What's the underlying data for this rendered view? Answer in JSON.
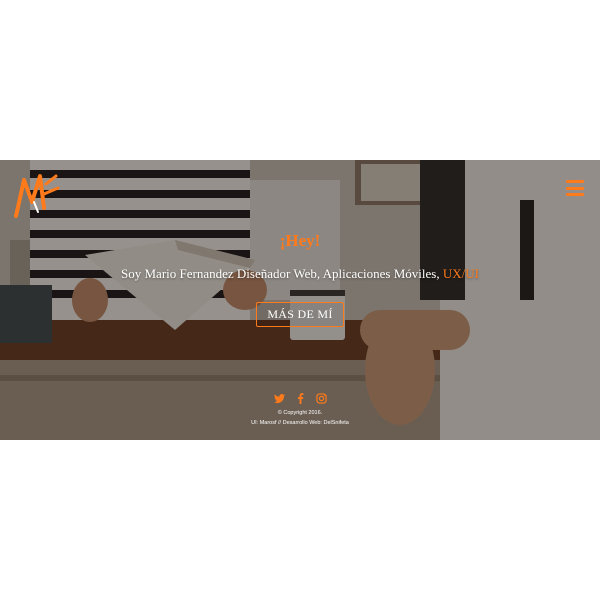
{
  "header": {
    "logo_icon": "mf-monogram-logo",
    "menu_icon": "hamburger-menu-icon"
  },
  "hero": {
    "greeting": "¡Hey!",
    "intro_prefix": "Soy Mario Fernandez Diseñador Web, Aplicaciones Móviles, ",
    "intro_accent": "UX/UI",
    "cta_label": "MÁS DE MÍ",
    "background_icon": "reading-at-cafe-photo"
  },
  "social": [
    {
      "name": "twitter",
      "icon": "twitter-icon"
    },
    {
      "name": "facebook",
      "icon": "facebook-icon"
    },
    {
      "name": "instagram",
      "icon": "instagram-icon"
    }
  ],
  "footer": {
    "copyright": "© Copyright 2016.",
    "credits": "UI: Marosf // Desarrollo Web: DelSnifeta"
  },
  "colors": {
    "accent": "#ff7a1a",
    "text": "#ffffff",
    "page": "#ffffff"
  }
}
